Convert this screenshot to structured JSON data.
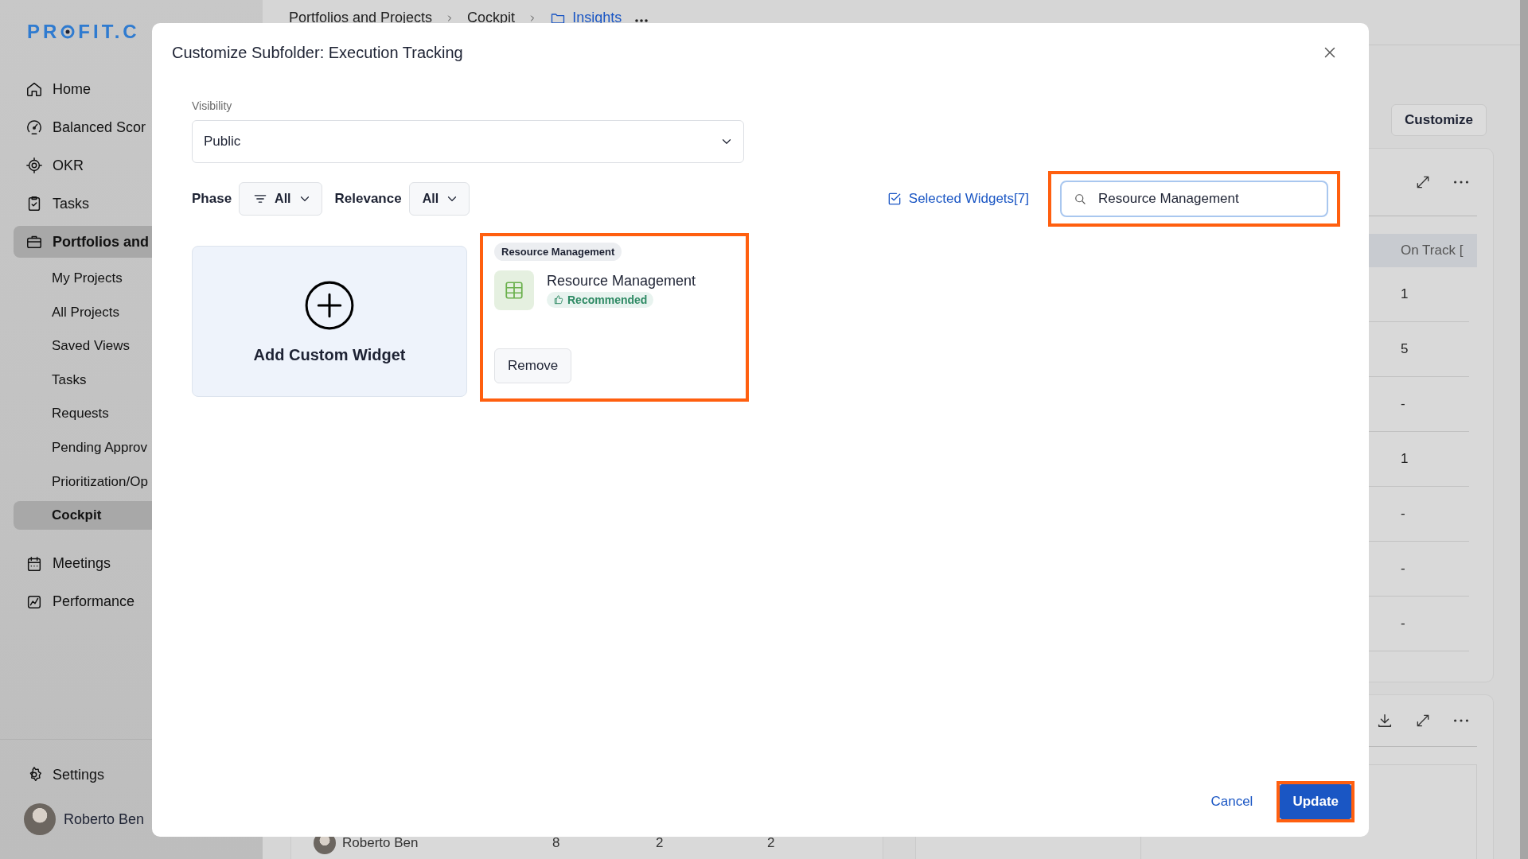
{
  "logo": {
    "left": "PR",
    "right": "FIT.C"
  },
  "sidebar": {
    "items": [
      {
        "label": "Home",
        "kind": "main",
        "selected": false
      },
      {
        "label": "Balanced Scor",
        "kind": "main",
        "selected": false
      },
      {
        "label": "OKR",
        "kind": "main",
        "selected": false
      },
      {
        "label": "Tasks",
        "kind": "main",
        "selected": false
      },
      {
        "label": "Portfolios and",
        "kind": "main",
        "selected": true
      },
      {
        "label": "My Projects",
        "kind": "sub",
        "selected": false
      },
      {
        "label": "All Projects",
        "kind": "sub",
        "selected": false
      },
      {
        "label": "Saved Views",
        "kind": "sub",
        "selected": false
      },
      {
        "label": "Tasks",
        "kind": "sub",
        "selected": false
      },
      {
        "label": "Requests",
        "kind": "sub",
        "selected": false
      },
      {
        "label": "Pending Approv",
        "kind": "sub",
        "selected": false
      },
      {
        "label": "Prioritization/Op",
        "kind": "sub",
        "selected": false
      },
      {
        "label": "Cockpit",
        "kind": "sub",
        "selected": true
      },
      {
        "label": "Meetings",
        "kind": "main",
        "selected": false
      },
      {
        "label": "Performance",
        "kind": "main",
        "selected": false
      }
    ],
    "settings": "Settings",
    "user": "Roberto Ben"
  },
  "breadcrumb": [
    {
      "label": "Portfolios and Projects",
      "selected": false
    },
    {
      "label": "Cockpit",
      "selected": false
    },
    {
      "label": "Insights",
      "selected": true
    }
  ],
  "right_panel": {
    "customize": "Customize",
    "table": {
      "header": "On Track [",
      "cells": [
        "1",
        "5",
        "-",
        "1",
        "-",
        "-",
        "-"
      ]
    }
  },
  "left_panel": {
    "row": {
      "name": "Roberto Ben",
      "values": [
        "8",
        "2",
        "2"
      ]
    }
  },
  "modal": {
    "title": "Customize Subfolder: Execution Tracking",
    "visibility": {
      "label": "Visibility",
      "value": "Public"
    },
    "filters": [
      {
        "label": "Phase",
        "value": "All",
        "kind": "with-icon"
      },
      {
        "label": "Relevance",
        "value": "All",
        "kind": "plain"
      }
    ],
    "selected_widgets": "Selected Widgets[7]",
    "search": {
      "value": "Resource Management",
      "highlighted": true
    },
    "add_widget": "Add Custom Widget",
    "widgets": [
      {
        "tag": "Resource Management",
        "title": "Resource Management",
        "badge": "Recommended",
        "button": "Remove",
        "highlighted": true
      }
    ],
    "cancel": "Cancel",
    "update": {
      "label": "Update",
      "highlighted": true
    }
  }
}
